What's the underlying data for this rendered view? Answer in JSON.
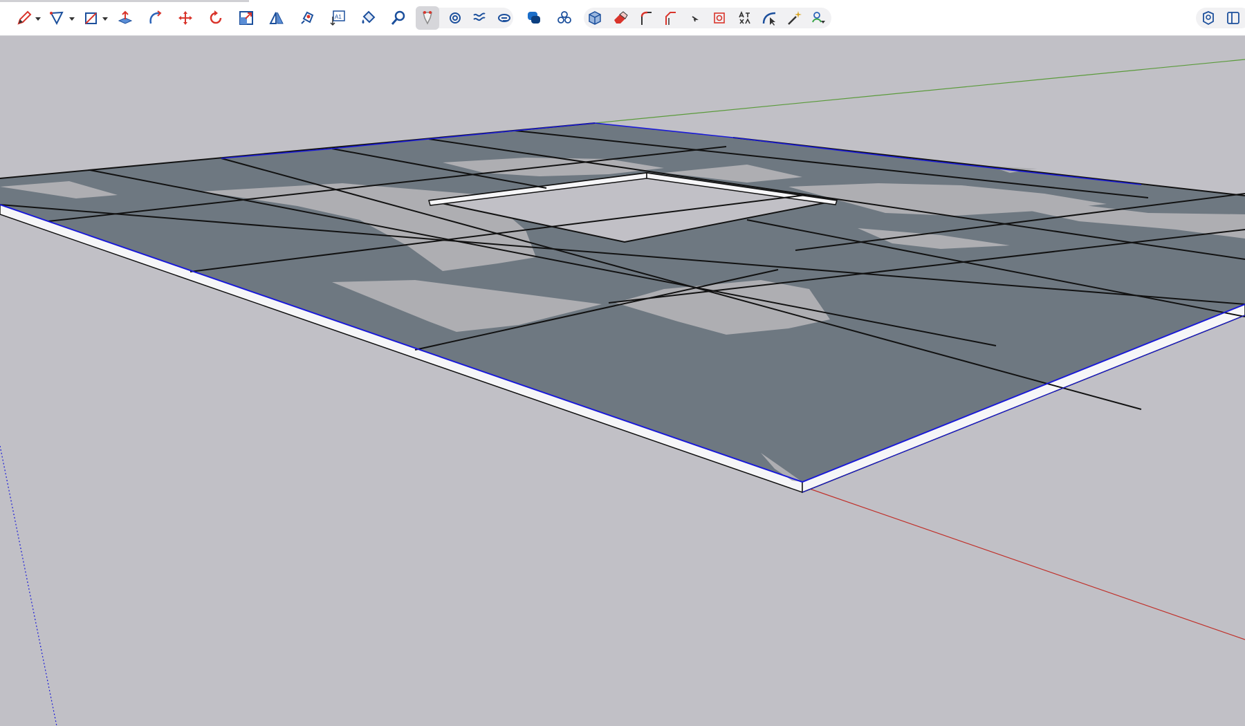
{
  "toolbar": {
    "tools": [
      {
        "name": "pencil-line-tool-icon",
        "color": "#d9342b"
      },
      {
        "name": "polygon-shape-tool-icon",
        "color": "#1b4f9c"
      },
      {
        "name": "rectangle-tool-icon",
        "color": "#1b4f9c"
      },
      {
        "name": "push-pull-tool-icon",
        "color": "#2a63b8"
      },
      {
        "name": "follow-me-tool-icon",
        "color": "#2a63b8"
      },
      {
        "name": "move-tool-icon",
        "color": "#d9342b"
      },
      {
        "name": "rotate-tool-icon",
        "color": "#d9342b"
      },
      {
        "name": "scale-tool-icon",
        "color": "#1b4f9c"
      },
      {
        "name": "flip-tool-icon",
        "color": "#1b4f9c"
      },
      {
        "name": "tape-measure-tool-icon",
        "color": "#1b4f9c"
      },
      {
        "name": "text-tool-icon",
        "color": "#1b4f9c"
      },
      {
        "name": "paint-bucket-tool-icon",
        "color": "#1b4f9c"
      },
      {
        "name": "zoom-tool-icon",
        "color": "#1b4f9c"
      },
      {
        "name": "select-tool-icon",
        "color": "#8a8a8a"
      },
      {
        "name": "orbit-tool-icon",
        "color": "#1b4f9c"
      },
      {
        "name": "section-plane-tool-icon",
        "color": "#1b4f9c"
      },
      {
        "name": "walk-tool-icon",
        "color": "#1b4f9c"
      },
      {
        "name": "speech-bubble-icon",
        "color": "#1b4f9c"
      },
      {
        "name": "components-icon",
        "color": "#1b4f9c"
      },
      {
        "name": "cube-view-icon",
        "color": "#1b4f9c"
      },
      {
        "name": "eraser-tool-icon",
        "color": "#d9342b"
      },
      {
        "name": "fillet-tool-icon",
        "color": "#d9342b"
      },
      {
        "name": "chamfer-tool-icon",
        "color": "#d9342b"
      },
      {
        "name": "small-arrow-tool-icon",
        "color": "#333333"
      },
      {
        "name": "target-tool-icon",
        "color": "#d9342b"
      },
      {
        "name": "text-style-tool-icon",
        "color": "#333333"
      },
      {
        "name": "arc-cursor-tool-icon",
        "color": "#1b4f9c"
      },
      {
        "name": "magic-wand-tool-icon",
        "color": "#d9a520"
      },
      {
        "name": "extension-dropdown-icon",
        "color": "#2a63b8"
      },
      {
        "name": "instructor-panel-icon",
        "color": "#1b4f9c"
      },
      {
        "name": "panel-toggle-icon",
        "color": "#1b4f9c"
      }
    ],
    "text_tool_label": "A1"
  },
  "scene": {
    "background": "#c1c0c6",
    "tile_color": "#6e7881",
    "highlight_color": "#aeaeb2",
    "edge_color": "#111111",
    "outline_color": "#1a1ad8",
    "red_axis_color": "#c0302a",
    "green_axis_color": "#5a9a3a",
    "blue_axis_color": "#1a1ad8"
  }
}
